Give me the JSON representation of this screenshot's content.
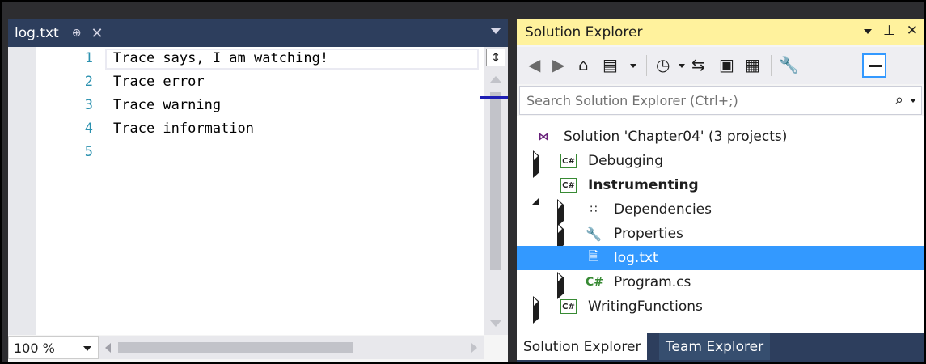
{
  "editor": {
    "tab": {
      "label": "log.txt",
      "pin_icon": "pin-icon",
      "close_icon": "close-icon"
    },
    "line_numbers": [
      "1",
      "2",
      "3",
      "4",
      "5"
    ],
    "lines": [
      "Trace says, I am watching!",
      "Trace error",
      "Trace warning",
      "Trace information",
      ""
    ],
    "zoom": "100 %"
  },
  "solution_explorer": {
    "title": "Solution Explorer",
    "search_placeholder": "Search Solution Explorer (Ctrl+;)",
    "tree": {
      "solution": "Solution 'Chapter04' (3 projects)",
      "debugging": "Debugging",
      "instrumenting": "Instrumenting",
      "dependencies": "Dependencies",
      "properties": "Properties",
      "log_txt": "log.txt",
      "program_cs": "Program.cs",
      "writing_functions": "WritingFunctions"
    },
    "tabs": [
      "Solution Explorer",
      "Team Explorer"
    ]
  },
  "colors": {
    "title_highlight": "#fff29d",
    "selection": "#3399ff",
    "tab_strip": "#2d3e5d",
    "line_number": "#2b91af"
  }
}
